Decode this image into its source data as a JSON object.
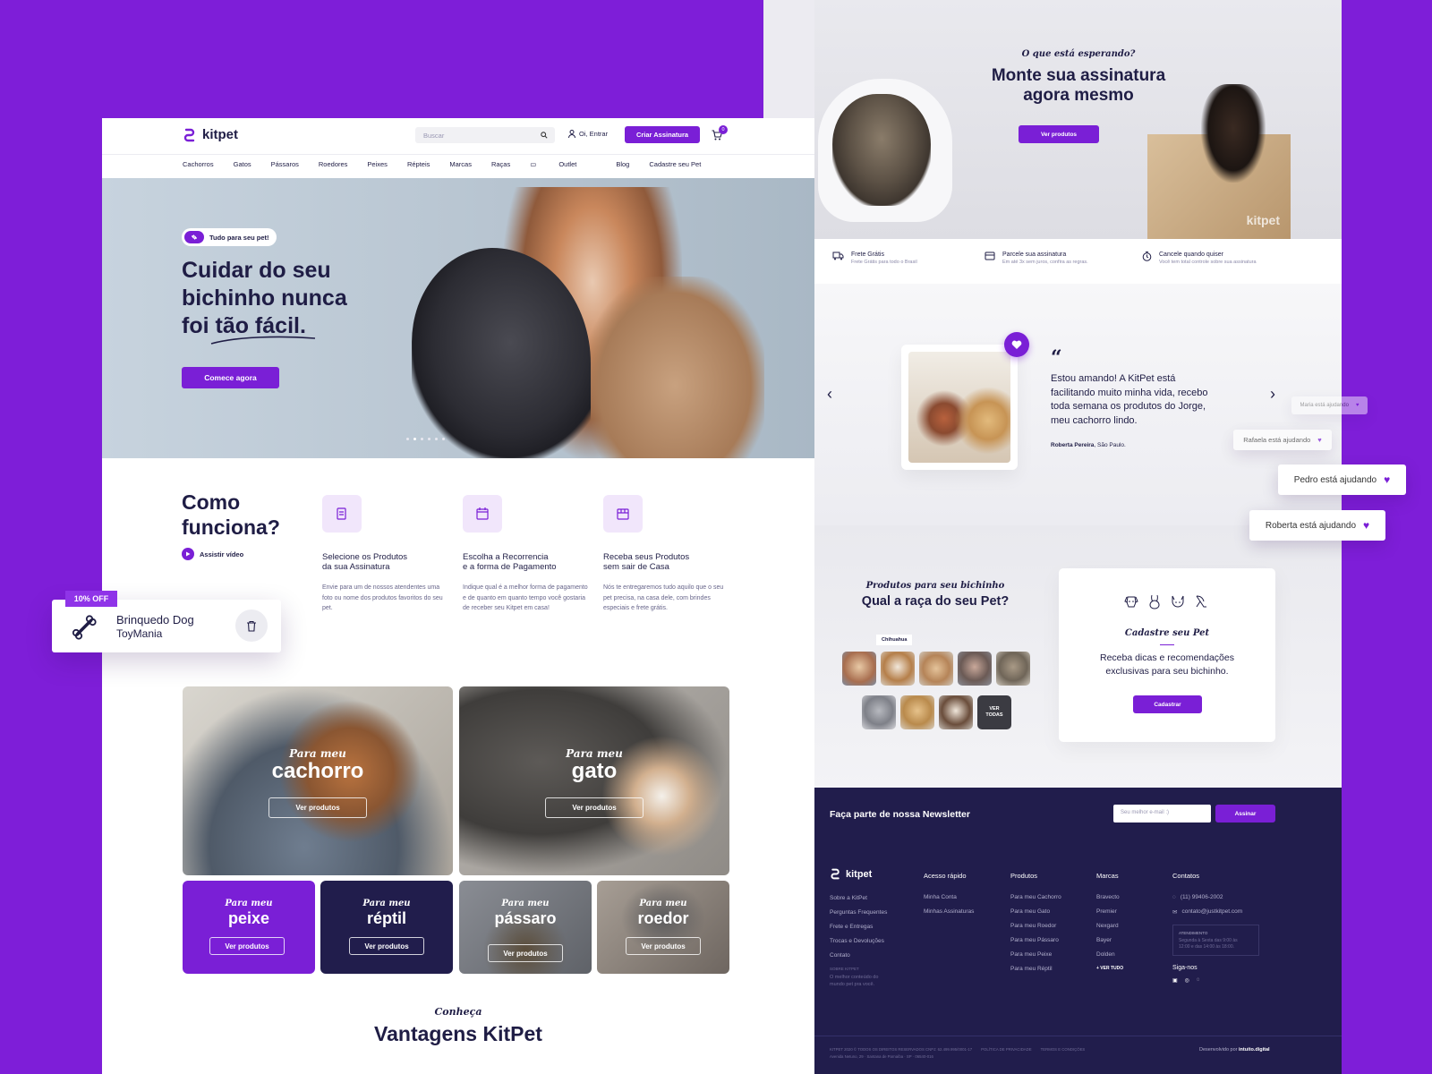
{
  "brand": "kitpet",
  "header": {
    "search_placeholder": "Buscar",
    "login": "Oi, Entrar",
    "cta": "Criar Assinatura",
    "cart_count": "0"
  },
  "nav": [
    "Cachorros",
    "Gatos",
    "Pássaros",
    "Roedores",
    "Peixes",
    "Répteis",
    "Marcas",
    "Raças",
    "Outlet",
    "Blog",
    "Cadastre seu Pet"
  ],
  "hero": {
    "badge": "Tudo para seu pet!",
    "title_1": "Cuidar do seu",
    "title_2": "bichinho nunca",
    "title_3": "foi tão fácil.",
    "cta": "Comece agora"
  },
  "how": {
    "title_1": "Como",
    "title_2": "funciona?",
    "video": "Assistir vídeo",
    "steps": [
      {
        "title_1": "Selecione os Produtos",
        "title_2": "da sua Assinatura",
        "text": "Envie para um de nossos atendentes uma foto ou nome dos produtos favoritos do seu pet."
      },
      {
        "title_1": "Escolha a Recorrencia",
        "title_2": "e a forma de Pagamento",
        "text": "Indique qual é a melhor forma de pagamento e de quanto em quanto tempo você gostaria de receber seu Kitpet em casa!"
      },
      {
        "title_1": "Receba seus Produtos",
        "title_2": "sem sair de Casa",
        "text": "Nós te entregaremos tudo aquilo que o seu pet precisa, na casa dele, com brindes especiais e frete grátis."
      }
    ]
  },
  "promo": {
    "badge": "10% OFF",
    "name": "Brinquedo Dog",
    "brand": "ToyMania"
  },
  "categories": {
    "prefix": "Para meu",
    "button": "Ver produtos",
    "items": [
      "cachorro",
      "gato",
      "peixe",
      "réptil",
      "pássaro",
      "roedor"
    ]
  },
  "advantages": {
    "kicker": "Conheça",
    "title": "Vantagens KitPet"
  },
  "cta_top": {
    "kicker": "O que está esperando?",
    "title_1": "Monte sua assinatura",
    "title_2": "agora mesmo",
    "button": "Ver produtos",
    "box_logo": "kitpet"
  },
  "features": [
    {
      "title": "Frete Grátis",
      "text": "Frete Grátis para todo o Brasil"
    },
    {
      "title": "Parcele sua assinatura",
      "text": "Em até 3x sem juros, confira as regras."
    },
    {
      "title": "Cancele quando quiser",
      "text": "Você tem total controle sobre sua assinatura"
    }
  ],
  "testimonial": {
    "quote_mark": "“",
    "text_1": "Estou amando! A KitPet está",
    "text_2": "facilitando muito minha vida, recebo",
    "text_3": "toda semana os produtos do Jorge,",
    "text_4": "meu cachorro lindo.",
    "author": "Roberta Pereira",
    "city": ", São Paulo.",
    "prev": "‹",
    "next": "›"
  },
  "toasts": [
    "Maria está ajudando",
    "Rafaela está ajudando",
    "Pedro está ajudando",
    "Roberta está ajudando"
  ],
  "breeds": {
    "kicker": "Produtos para seu bichinho",
    "title": "Qual a raça do seu Pet?",
    "tooltip": "Chihuahua",
    "see_all": "VER TODAS"
  },
  "register": {
    "title": "Cadastre seu Pet",
    "text_1": "Receba dicas e recomendações",
    "text_2": "exclusivas para seu bichinho.",
    "button": "Cadastrar"
  },
  "newsletter": {
    "title": "Faça parte de nossa Newsletter",
    "placeholder": "Seu melhor e-mail :)",
    "button": "Assinar"
  },
  "footer": {
    "brand": "kitpet",
    "col1": [
      "Sobre a KitPet",
      "Perguntas Frequentes",
      "Frete e Entregas",
      "Trocas e Devoluções",
      "Contato"
    ],
    "about_title": "SOBRE KITPET",
    "about_text_1": "O melhor conteúdo do",
    "about_text_2": "mundo pet pra você.",
    "col2_title": "Acesso rápido",
    "col2": [
      "Minha Conta",
      "Minhas Assinaturas"
    ],
    "col3_title": "Produtos",
    "col3": [
      "Para meu Cachorro",
      "Para meu Gato",
      "Para meu Roedor",
      "Para meu Pássaro",
      "Para meu Peixe",
      "Para meu Réptil"
    ],
    "col4_title": "Marcas",
    "col4": [
      "Bravecto",
      "Premier",
      "Nexgard",
      "Bayer",
      "Dolden"
    ],
    "see_all": "+ VER TUDO",
    "col5_title": "Contatos",
    "phone": "(11) 99406-2002",
    "email": "contato@justkitpet.com",
    "hours_title": "ATENDIMENTO",
    "hours_1": "Segunda à Sexta das 9:00 às",
    "hours_2": "12:00 e das 14:00 às 18:00.",
    "social_title": "Siga-nos",
    "legal_1": "KITPET 2020 © TODOS OS DIREITOS RESERVADOS CNPJ: 62.499.995/0001-17",
    "legal_2": "POLÍTICA DE PRIVACIDADE",
    "legal_3": "TERMOS E CONDIÇÕES",
    "address": "Avenida Netuno, 29 · Santana de Parnaíba · SP · 06540-016",
    "dev_label": "Desenvolvido por",
    "dev": "intuito.digital"
  }
}
